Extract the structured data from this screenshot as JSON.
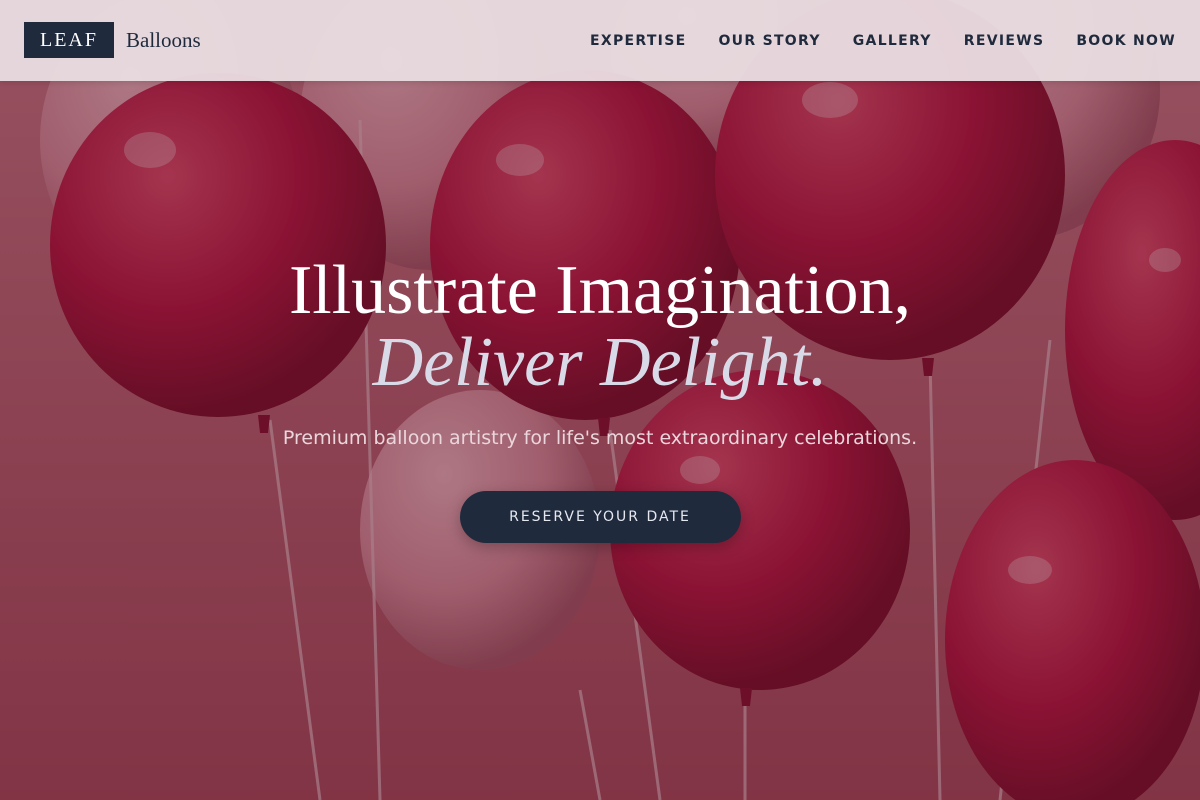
{
  "header": {
    "logo_box": "LEAF",
    "logo_text": "Balloons",
    "nav": [
      "EXPERTISE",
      "OUR STORY",
      "GALLERY",
      "REVIEWS",
      "BOOK NOW"
    ]
  },
  "hero": {
    "headline_line1": "Illustrate Imagination,",
    "headline_line2": "Deliver Delight.",
    "subtitle": "Premium balloon artistry for life's most extraordinary celebrations.",
    "cta_label": "RESERVE YOUR DATE",
    "background_image": "balloons-photo"
  },
  "colors": {
    "navy": "#1f2a3d",
    "header_bg": "#e8dce0",
    "balloon_red": "#b3123e",
    "overlay": "#5a1428"
  }
}
